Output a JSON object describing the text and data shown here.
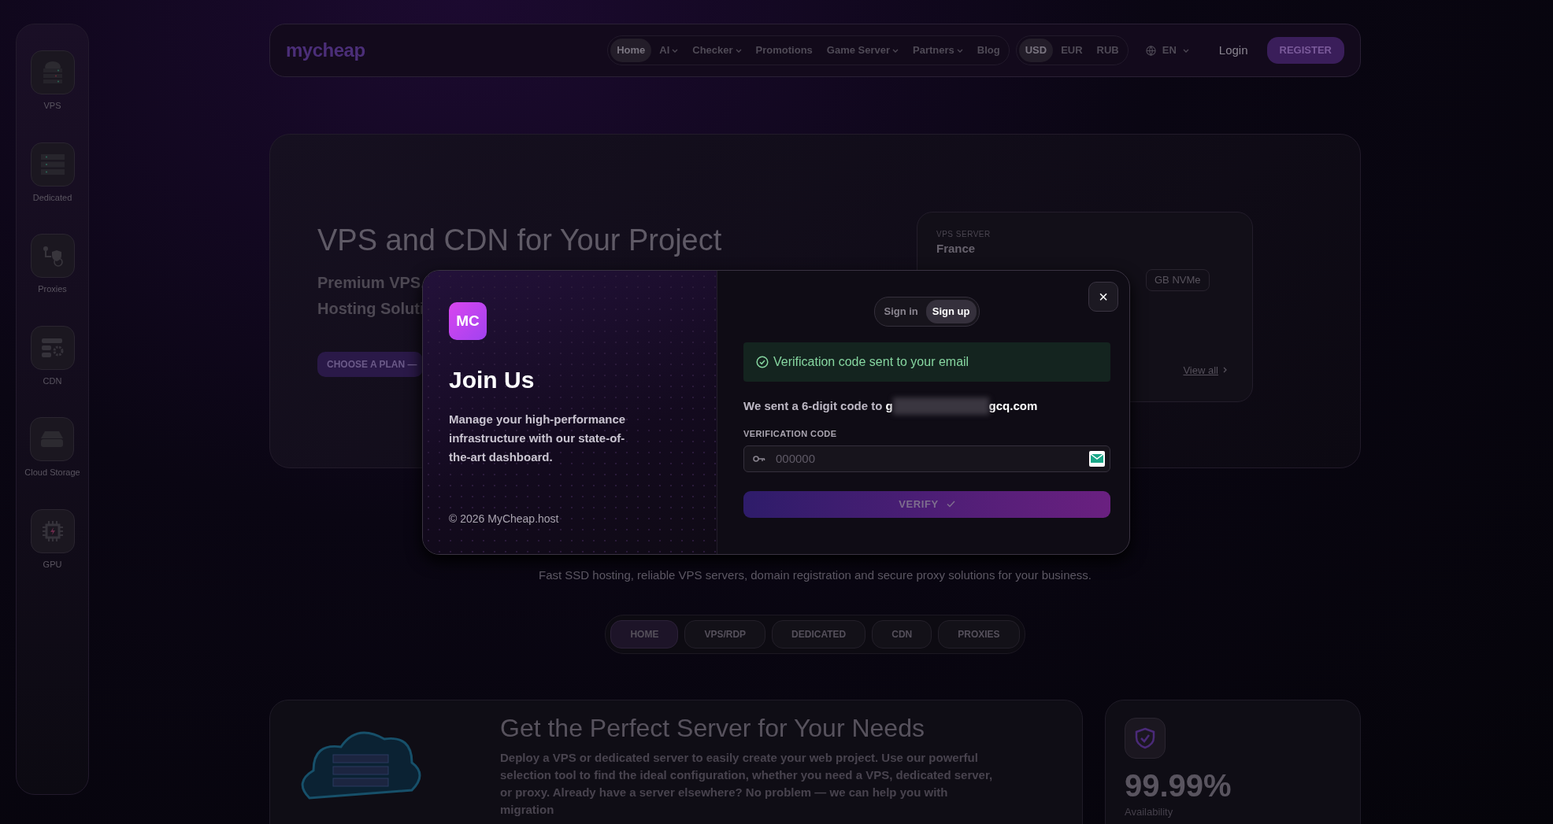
{
  "sidebar": {
    "items": [
      {
        "label": "VPS",
        "kind": "vps"
      },
      {
        "label": "Dedicated",
        "kind": "dedicated"
      },
      {
        "label": "Proxies",
        "kind": "proxies"
      },
      {
        "label": "CDN",
        "kind": "cdn"
      },
      {
        "label": "Cloud Storage",
        "kind": "storage"
      },
      {
        "label": "GPU",
        "kind": "gpu"
      }
    ]
  },
  "nav": {
    "logo": "mycheap",
    "links": [
      {
        "label": "Home",
        "dropdown": false,
        "selected": true
      },
      {
        "label": "AI",
        "dropdown": true,
        "selected": false
      },
      {
        "label": "Checker",
        "dropdown": true,
        "selected": false
      },
      {
        "label": "Promotions",
        "dropdown": false,
        "selected": false
      },
      {
        "label": "Game Server",
        "dropdown": true,
        "selected": false
      },
      {
        "label": "Partners",
        "dropdown": true,
        "selected": false
      },
      {
        "label": "Blog",
        "dropdown": false,
        "selected": false
      }
    ],
    "currencies": [
      {
        "label": "USD",
        "selected": true
      },
      {
        "label": "EUR",
        "selected": false
      },
      {
        "label": "RUB",
        "selected": false
      }
    ],
    "language": "EN",
    "login": "Login",
    "register": "REGISTER"
  },
  "hero": {
    "title": "VPS and CDN for Your Project",
    "subtitle_lines": [
      "Premium VPS,",
      "Hosting Soluti"
    ],
    "cta": "CHOOSE A PLAN —",
    "server_card": {
      "eyebrow": "VPS SERVER",
      "location": "France",
      "spec": "GB NVMe",
      "link": "View all"
    }
  },
  "tagline": "Fast SSD hosting, reliable VPS servers, domain registration and secure proxy solutions for your business.",
  "section_tabs": [
    {
      "label": "HOME",
      "selected": true
    },
    {
      "label": "VPS/RDP",
      "selected": false
    },
    {
      "label": "DEDICATED",
      "selected": false
    },
    {
      "label": "CDN",
      "selected": false
    },
    {
      "label": "PROXIES",
      "selected": false
    }
  ],
  "feature": {
    "title": "Get the Perfect Server for Your Needs",
    "text": "Deploy a VPS or dedicated server to easily create your web project. Use our powerful selection tool to find the ideal configuration, whether you need a VPS, dedicated server, or proxy. Already have a server elsewhere? No problem — we can help you with migration"
  },
  "stat": {
    "value": "99.99%",
    "label": "Availability"
  },
  "modal": {
    "logo": "MC",
    "title": "Join Us",
    "text": "Manage your high-performance infrastructure with our state-of-the-art dashboard.",
    "footer": "© 2026 MyCheap.host",
    "close": "×",
    "tabs": [
      {
        "label": "Sign in",
        "selected": false
      },
      {
        "label": "Sign up",
        "selected": true
      }
    ],
    "alert": "Verification code sent to your email",
    "sent_text": "We sent a 6-digit code to",
    "email_start": "g",
    "email_end": "gcq.com",
    "field_label": "VERIFICATION CODE",
    "placeholder": "000000",
    "button": "VERIFY"
  }
}
